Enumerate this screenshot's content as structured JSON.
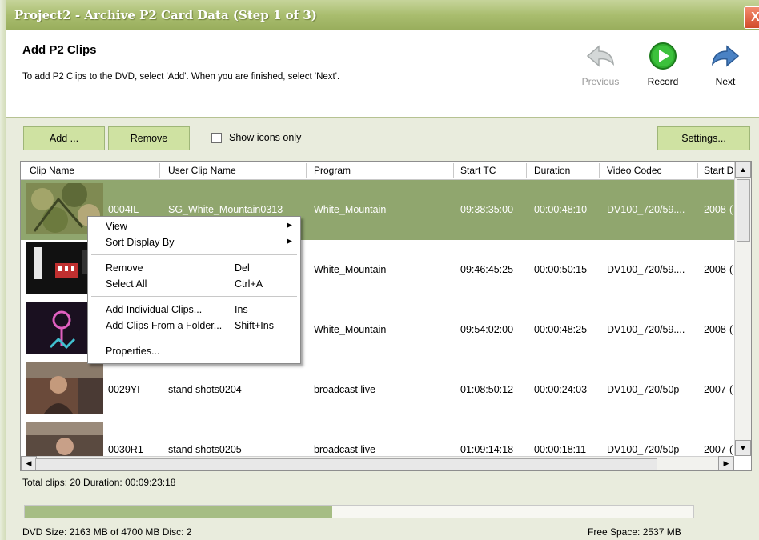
{
  "window": {
    "title": "Project2 - Archive P2 Card Data (Step 1 of 3)",
    "close_glyph": "X"
  },
  "header": {
    "title": "Add P2 Clips",
    "subtitle": "To add P2 Clips to the DVD, select 'Add'. When you are finished, select 'Next'.",
    "previous_label": "Previous",
    "record_label": "Record",
    "next_label": "Next",
    "icons": [
      "back-arrow-icon",
      "record-play-icon",
      "forward-arrow-icon"
    ]
  },
  "toolbar": {
    "add_label": "Add ...",
    "remove_label": "Remove",
    "show_icons_label": "Show icons only",
    "show_icons_checked": false,
    "settings_label": "Settings..."
  },
  "table": {
    "columns": [
      "Clip Name",
      "User Clip Name",
      "Program",
      "Start TC",
      "Duration",
      "Video Codec",
      "Start D"
    ],
    "rows": [
      {
        "clip": "0004IL",
        "user": "SG_White_Mountain0313",
        "program": "White_Mountain",
        "start_tc": "09:38:35:00",
        "duration": "00:00:48:10",
        "codec": "DV100_720/59....",
        "start_d": "2008-(",
        "selected": true
      },
      {
        "clip": "",
        "user": "",
        "program": "White_Mountain",
        "start_tc": "09:46:45:25",
        "duration": "00:00:50:15",
        "codec": "DV100_720/59....",
        "start_d": "2008-(",
        "selected": false
      },
      {
        "clip": "",
        "user": "",
        "program": "White_Mountain",
        "start_tc": "09:54:02:00",
        "duration": "00:00:48:25",
        "codec": "DV100_720/59....",
        "start_d": "2008-(",
        "selected": false
      },
      {
        "clip": "0029YI",
        "user": "stand shots0204",
        "program": "broadcast live",
        "start_tc": "01:08:50:12",
        "duration": "00:00:24:03",
        "codec": "DV100_720/50p",
        "start_d": "2007-(",
        "selected": false
      },
      {
        "clip": "0030R1",
        "user": "stand shots0205",
        "program": "broadcast live",
        "start_tc": "01:09:14:18",
        "duration": "00:00:18:11",
        "codec": "DV100_720/50p",
        "start_d": "2007-(",
        "selected": false
      }
    ]
  },
  "context_menu": {
    "items": [
      {
        "label": "View",
        "shortcut": "",
        "submenu": true
      },
      {
        "label": "Sort Display By",
        "shortcut": "",
        "submenu": true
      },
      {
        "label": "Remove",
        "shortcut": "Del",
        "submenu": false
      },
      {
        "label": "Select All",
        "shortcut": "Ctrl+A",
        "submenu": false
      },
      {
        "label": "Add  Individual Clips...",
        "shortcut": "Ins",
        "submenu": false
      },
      {
        "label": "Add Clips From a Folder...",
        "shortcut": "Shift+Ins",
        "submenu": false
      },
      {
        "label": "Properties...",
        "shortcut": "",
        "submenu": false
      }
    ]
  },
  "footer": {
    "total": "Total clips: 20   Duration: 00:09:23:18",
    "dvd_size": "DVD Size: 2163 MB of 4700 MB Disc: 2",
    "free_space": "Free Space: 2537 MB",
    "usage_fraction": 0.46
  },
  "colors": {
    "title_bar": "#a9bd6e",
    "selected_row": "#90a66e",
    "button": "#cfe2a2",
    "record_green": "#2fae2f",
    "arrow_blue": "#4a82c4"
  }
}
